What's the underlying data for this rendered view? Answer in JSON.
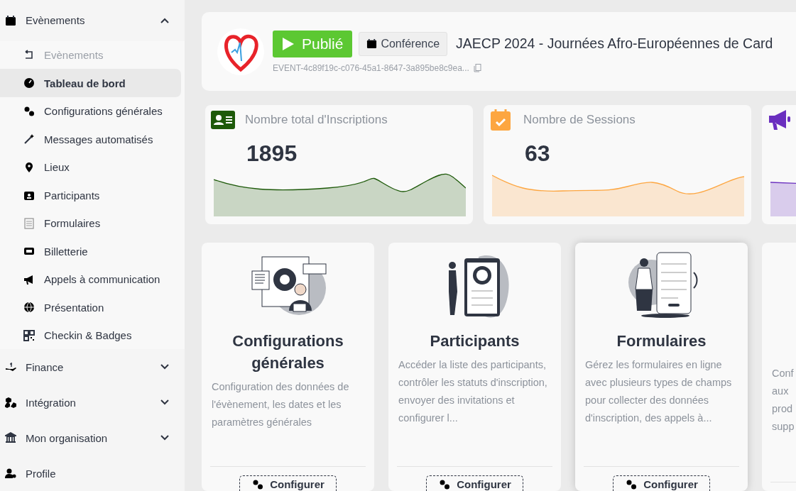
{
  "sidebar": {
    "groups": [
      {
        "label": "Evènements",
        "expanded": true,
        "children": [
          {
            "label": "Evènements",
            "kind": "back",
            "selected": false
          },
          {
            "label": "Tableau de bord",
            "kind": "link",
            "selected": true
          },
          {
            "label": "Configurations générales",
            "kind": "link",
            "selected": false
          },
          {
            "label": "Messages automatisés",
            "kind": "link",
            "selected": false
          },
          {
            "label": "Lieux",
            "kind": "link",
            "selected": false
          },
          {
            "label": "Participants",
            "kind": "link",
            "selected": false
          },
          {
            "label": "Formulaires",
            "kind": "link",
            "selected": false
          },
          {
            "label": "Billetterie",
            "kind": "link",
            "selected": false
          },
          {
            "label": "Appels à communication",
            "kind": "link",
            "selected": false
          },
          {
            "label": "Présentation",
            "kind": "link",
            "selected": false
          },
          {
            "label": "Checkin & Badges",
            "kind": "link",
            "selected": false
          }
        ]
      },
      {
        "label": "Finance",
        "expanded": false
      },
      {
        "label": "Intégration",
        "expanded": false
      },
      {
        "label": "Mon organisation",
        "expanded": false
      },
      {
        "label": "Profile"
      }
    ]
  },
  "event": {
    "status": "Publié",
    "type": "Conférence",
    "title": "JAECP 2024 - Journées Afro-Européennes de Card",
    "id": "EVENT-4c89f19c-c076-45a1-8647-3a895be8c9ea..."
  },
  "stats": [
    {
      "kind": "registrations",
      "label": "Nombre total d'Inscriptions",
      "value": "1895",
      "color": "#1e5a0a"
    },
    {
      "kind": "sessions",
      "label": "Nombre de Sessions",
      "value": "63",
      "color": "#fda640"
    },
    {
      "kind": "calls",
      "color": "#6a2fbf"
    }
  ],
  "cards": [
    {
      "kind": "settings",
      "title": "Configurations générales",
      "description": "Configuration des données de l'évènement, les dates et les paramètres générales",
      "button": "Configurer",
      "hovered": false
    },
    {
      "kind": "profile",
      "title": "Participants",
      "description": "Accéder la liste des participants, contrôler les statuts d'inscription, envoyer des invitations et configurer l...",
      "button": "Configurer",
      "hovered": false
    },
    {
      "kind": "form",
      "title": "Formulaires",
      "description": "Gérez les formulaires en ligne avec plusieurs types de champs pour collecter des données d'inscription, des appels à...",
      "button": "Configurer",
      "hovered": true
    },
    {
      "kind": "cut",
      "description": "Conf\naux\nprod\nsupp",
      "hovered": false
    }
  ]
}
